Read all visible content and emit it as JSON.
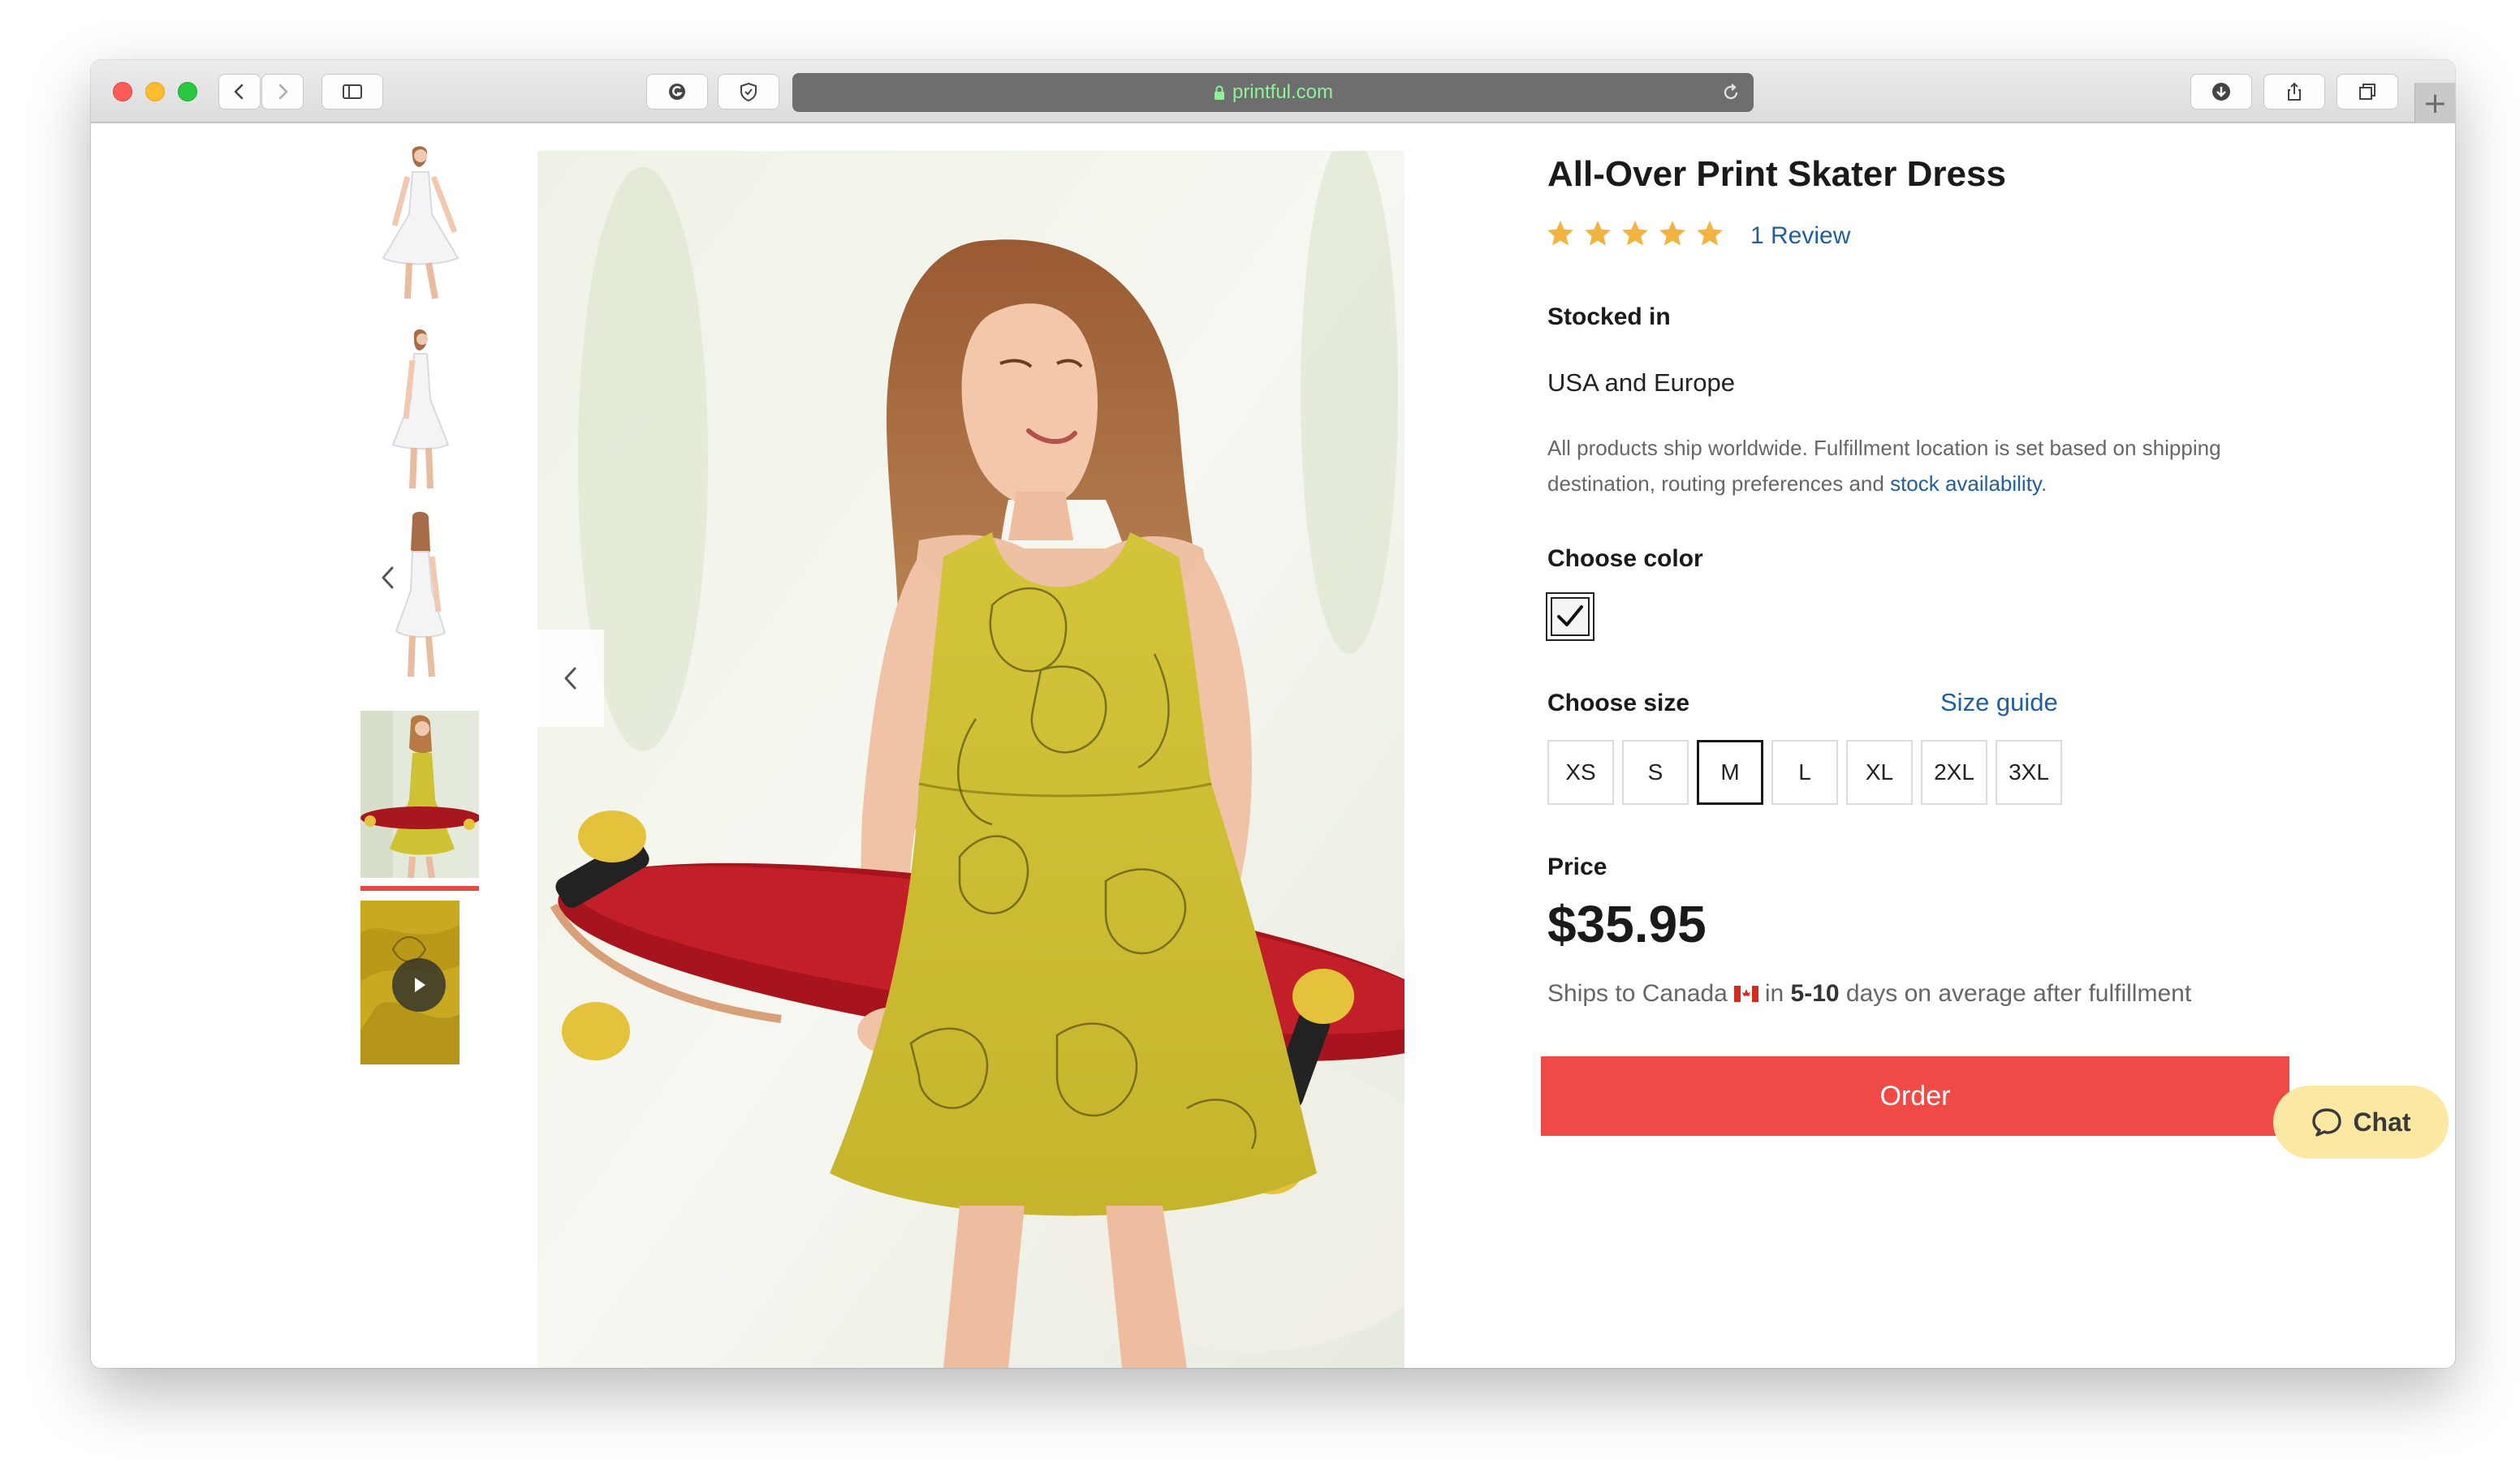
{
  "browser": {
    "url": "printful.com",
    "new_tab_glyph": "+"
  },
  "gallery": {
    "thumbnails": [
      {
        "name": "thumb-white-dress-front",
        "kind": "image"
      },
      {
        "name": "thumb-white-dress-side",
        "kind": "image"
      },
      {
        "name": "thumb-white-dress-back",
        "kind": "image"
      },
      {
        "name": "thumb-yellow-dress-skateboard",
        "kind": "image",
        "active": true
      },
      {
        "name": "thumb-yellow-dress-video",
        "kind": "video"
      }
    ],
    "main_image": "yellow floral skater dress with red longboard"
  },
  "product": {
    "title": "All-Over Print Skater Dress",
    "rating": 5,
    "review_link": "1 Review",
    "stocked_label": "Stocked in",
    "stocked_value": "USA and Europe",
    "ship_note": "All products ship worldwide. Fulfillment location is set based on shipping destination, routing preferences and ",
    "ship_note_link": "stock availability",
    "ship_note_end": ".",
    "color_label": "Choose color",
    "size_label": "Choose size",
    "size_guide": "Size guide",
    "sizes": [
      "XS",
      "S",
      "M",
      "L",
      "XL",
      "2XL",
      "3XL"
    ],
    "selected_size": "M",
    "price_label": "Price",
    "price": "$35.95",
    "ships_prefix": "Ships to Canada",
    "ships_in": "in",
    "ships_days": "5-10",
    "ships_suffix": "days on average after fulfillment",
    "order_button": "Order"
  },
  "chat": {
    "label": "Chat"
  },
  "colors": {
    "accent_red": "#ef4a45",
    "link_blue": "#1f5f9c",
    "star_gold": "#f2b441",
    "chat_bg": "#fbe9a3",
    "dress_yellow": "#cfc235"
  }
}
